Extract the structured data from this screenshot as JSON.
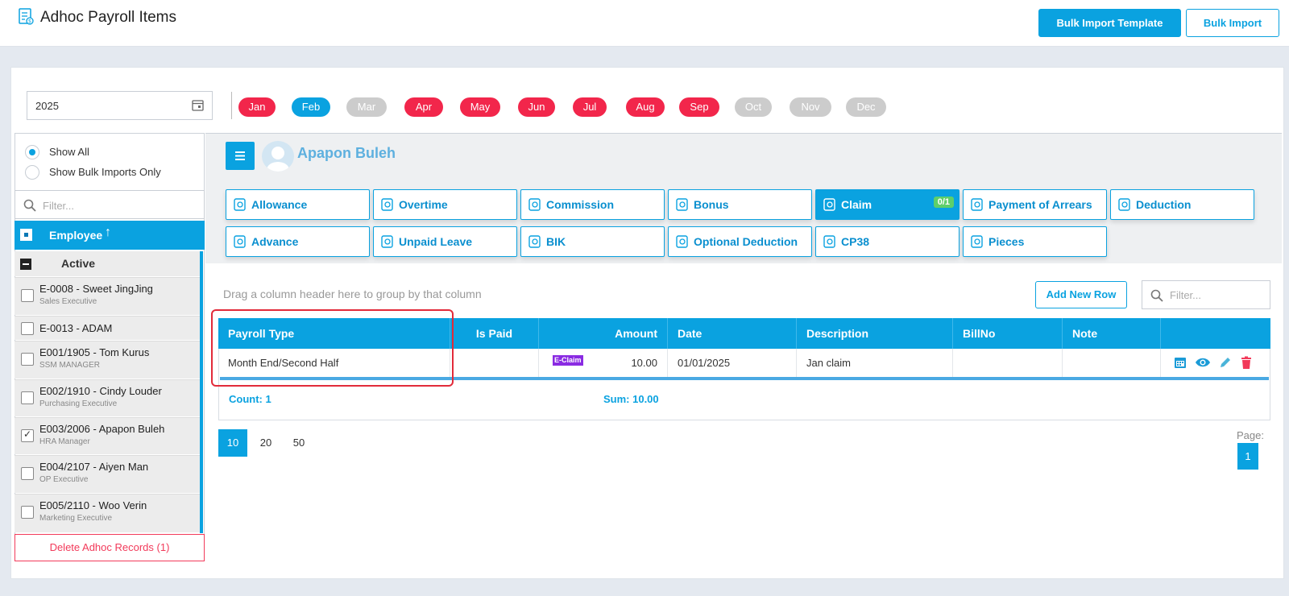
{
  "header": {
    "title": "Adhoc Payroll Items",
    "bulk_template_label": "Bulk Import Template",
    "bulk_import_label": "Bulk Import"
  },
  "filters": {
    "year": "2025",
    "months": [
      {
        "label": "Jan",
        "state": "red"
      },
      {
        "label": "Feb",
        "state": "selected"
      },
      {
        "label": "Mar",
        "state": "disabled"
      },
      {
        "label": "Apr",
        "state": "red"
      },
      {
        "label": "May",
        "state": "red"
      },
      {
        "label": "Jun",
        "state": "red"
      },
      {
        "label": "Jul",
        "state": "red"
      },
      {
        "label": "Aug",
        "state": "red"
      },
      {
        "label": "Sep",
        "state": "red"
      },
      {
        "label": "Oct",
        "state": "disabled"
      },
      {
        "label": "Nov",
        "state": "disabled"
      },
      {
        "label": "Dec",
        "state": "disabled"
      }
    ]
  },
  "sidebar": {
    "show_all_label": "Show All",
    "show_bulk_label": "Show Bulk Imports Only",
    "filter_placeholder": "Filter...",
    "employee_header": "Employee",
    "sort_glyph": "↑",
    "group_label": "Active",
    "employees": [
      {
        "name": "E-0008 - Sweet JingJing",
        "role": "Sales Executive",
        "checked": false
      },
      {
        "name": "E-0013 - ADAM",
        "role": "",
        "checked": false
      },
      {
        "name": "E001/1905 - Tom Kurus",
        "role": "SSM MANAGER",
        "checked": false
      },
      {
        "name": "E002/1910 - Cindy Louder",
        "role": "Purchasing Executive",
        "checked": false
      },
      {
        "name": "E003/2006 - Apapon Buleh",
        "role": "HRA Manager",
        "checked": true
      },
      {
        "name": "E004/2107 - Aiyen Man",
        "role": "OP Executive",
        "checked": false
      },
      {
        "name": "E005/2110 - Woo Verin",
        "role": "Marketing Executive",
        "checked": false
      }
    ],
    "delete_label": "Delete Adhoc Records (1)"
  },
  "main": {
    "employee_name": "Apapon Buleh",
    "tabs": [
      {
        "label": "Allowance",
        "icon": "allowance-icon"
      },
      {
        "label": "Overtime",
        "icon": "overtime-icon"
      },
      {
        "label": "Commission",
        "icon": "commission-icon"
      },
      {
        "label": "Bonus",
        "icon": "bonus-icon"
      },
      {
        "label": "Claim",
        "icon": "claim-icon",
        "badge": "0/1",
        "active": true
      },
      {
        "label": "Payment of Arrears",
        "icon": "arrears-icon"
      },
      {
        "label": "Deduction",
        "icon": "deduction-icon"
      },
      {
        "label": "Advance",
        "icon": "advance-icon"
      },
      {
        "label": "Unpaid Leave",
        "icon": "unpaid-leave-icon"
      },
      {
        "label": "BIK",
        "icon": "bik-icon"
      },
      {
        "label": "Optional Deduction",
        "icon": "optional-deduction-icon"
      },
      {
        "label": "CP38",
        "icon": "cp38-icon"
      },
      {
        "label": "Pieces",
        "icon": "pieces-icon"
      }
    ],
    "grid": {
      "group_hint": "Drag a column header here to group by that column",
      "add_row_label": "Add New Row",
      "filter_placeholder": "Filter...",
      "columns": [
        "Payroll Type",
        "Is Paid",
        "Amount",
        "Date",
        "Description",
        "BillNo",
        "Note"
      ],
      "rows": [
        {
          "payroll_type": "Month End/Second Half",
          "is_paid": "",
          "tag": "E-Claim",
          "amount": "10.00",
          "date": "01/01/2025",
          "description": "Jan claim",
          "billno": "",
          "note": ""
        }
      ],
      "count_label": "Count: 1",
      "sum_label": "Sum: 10.00"
    },
    "paging": {
      "sizes": [
        "10",
        "20",
        "50"
      ],
      "active_size": "10",
      "page_label": "Page:",
      "current_page": "1"
    }
  },
  "colors": {
    "accent": "#0aa2e0",
    "month_red": "#f2264b",
    "month_disabled": "#cccccc",
    "danger": "#f23a5a",
    "badge_green": "#5ecf6a",
    "eclaim_purple": "#8a2be2"
  }
}
